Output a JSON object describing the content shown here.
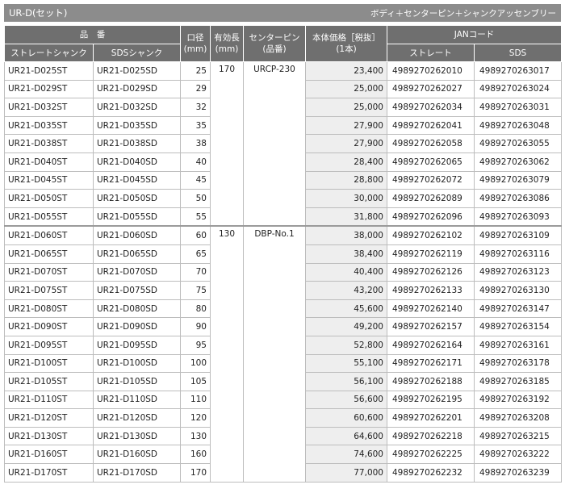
{
  "title": {
    "left": "UR-D(セット)",
    "right": "ボディ＋センターピン＋シャンクアッセンブリー"
  },
  "headers": {
    "hinban": "品　番",
    "straight_shank": "ストレートシャンク",
    "sds_shank": "SDSシャンク",
    "diameter": "口径\n(mm)",
    "effective_length": "有効長\n(mm)",
    "center_pin": "センターピン\n(品番)",
    "price": "本体価格［税抜］\n(1本)",
    "jan": "JANコード",
    "jan_straight": "ストレート",
    "jan_sds": "SDS"
  },
  "groups": [
    {
      "effective_length": "170",
      "center_pin": "URCP-230",
      "rows": [
        {
          "st": "UR21-D025ST",
          "sd": "UR21-D025SD",
          "dia": "25",
          "price": "23,400",
          "jan_st": "4989270262010",
          "jan_sds": "4989270263017"
        },
        {
          "st": "UR21-D029ST",
          "sd": "UR21-D029SD",
          "dia": "29",
          "price": "25,000",
          "jan_st": "4989270262027",
          "jan_sds": "4989270263024"
        },
        {
          "st": "UR21-D032ST",
          "sd": "UR21-D032SD",
          "dia": "32",
          "price": "25,000",
          "jan_st": "4989270262034",
          "jan_sds": "4989270263031"
        },
        {
          "st": "UR21-D035ST",
          "sd": "UR21-D035SD",
          "dia": "35",
          "price": "27,900",
          "jan_st": "4989270262041",
          "jan_sds": "4989270263048"
        },
        {
          "st": "UR21-D038ST",
          "sd": "UR21-D038SD",
          "dia": "38",
          "price": "27,900",
          "jan_st": "4989270262058",
          "jan_sds": "4989270263055"
        },
        {
          "st": "UR21-D040ST",
          "sd": "UR21-D040SD",
          "dia": "40",
          "price": "28,400",
          "jan_st": "4989270262065",
          "jan_sds": "4989270263062"
        },
        {
          "st": "UR21-D045ST",
          "sd": "UR21-D045SD",
          "dia": "45",
          "price": "28,800",
          "jan_st": "4989270262072",
          "jan_sds": "4989270263079"
        },
        {
          "st": "UR21-D050ST",
          "sd": "UR21-D050SD",
          "dia": "50",
          "price": "30,000",
          "jan_st": "4989270262089",
          "jan_sds": "4989270263086"
        },
        {
          "st": "UR21-D055ST",
          "sd": "UR21-D055SD",
          "dia": "55",
          "price": "31,800",
          "jan_st": "4989270262096",
          "jan_sds": "4989270263093"
        }
      ]
    },
    {
      "effective_length": "130",
      "center_pin": "DBP-No.1",
      "rows": [
        {
          "st": "UR21-D060ST",
          "sd": "UR21-D060SD",
          "dia": "60",
          "price": "38,000",
          "jan_st": "4989270262102",
          "jan_sds": "4989270263109"
        },
        {
          "st": "UR21-D065ST",
          "sd": "UR21-D065SD",
          "dia": "65",
          "price": "38,400",
          "jan_st": "4989270262119",
          "jan_sds": "4989270263116"
        },
        {
          "st": "UR21-D070ST",
          "sd": "UR21-D070SD",
          "dia": "70",
          "price": "40,400",
          "jan_st": "4989270262126",
          "jan_sds": "4989270263123"
        },
        {
          "st": "UR21-D075ST",
          "sd": "UR21-D075SD",
          "dia": "75",
          "price": "43,200",
          "jan_st": "4989270262133",
          "jan_sds": "4989270263130"
        },
        {
          "st": "UR21-D080ST",
          "sd": "UR21-D080SD",
          "dia": "80",
          "price": "45,600",
          "jan_st": "4989270262140",
          "jan_sds": "4989270263147"
        },
        {
          "st": "UR21-D090ST",
          "sd": "UR21-D090SD",
          "dia": "90",
          "price": "49,200",
          "jan_st": "4989270262157",
          "jan_sds": "4989270263154"
        },
        {
          "st": "UR21-D095ST",
          "sd": "UR21-D095SD",
          "dia": "95",
          "price": "52,800",
          "jan_st": "4989270262164",
          "jan_sds": "4989270263161"
        },
        {
          "st": "UR21-D100ST",
          "sd": "UR21-D100SD",
          "dia": "100",
          "price": "55,100",
          "jan_st": "4989270262171",
          "jan_sds": "4989270263178"
        },
        {
          "st": "UR21-D105ST",
          "sd": "UR21-D105SD",
          "dia": "105",
          "price": "56,100",
          "jan_st": "4989270262188",
          "jan_sds": "4989270263185"
        },
        {
          "st": "UR21-D110ST",
          "sd": "UR21-D110SD",
          "dia": "110",
          "price": "56,600",
          "jan_st": "4989270262195",
          "jan_sds": "4989270263192"
        },
        {
          "st": "UR21-D120ST",
          "sd": "UR21-D120SD",
          "dia": "120",
          "price": "60,600",
          "jan_st": "4989270262201",
          "jan_sds": "4989270263208"
        },
        {
          "st": "UR21-D130ST",
          "sd": "UR21-D130SD",
          "dia": "130",
          "price": "64,600",
          "jan_st": "4989270262218",
          "jan_sds": "4989270263215"
        },
        {
          "st": "UR21-D160ST",
          "sd": "UR21-D160SD",
          "dia": "160",
          "price": "74,600",
          "jan_st": "4989270262225",
          "jan_sds": "4989270263222"
        },
        {
          "st": "UR21-D170ST",
          "sd": "UR21-D170SD",
          "dia": "170",
          "price": "77,000",
          "jan_st": "4989270262232",
          "jan_sds": "4989270263239"
        }
      ]
    }
  ]
}
